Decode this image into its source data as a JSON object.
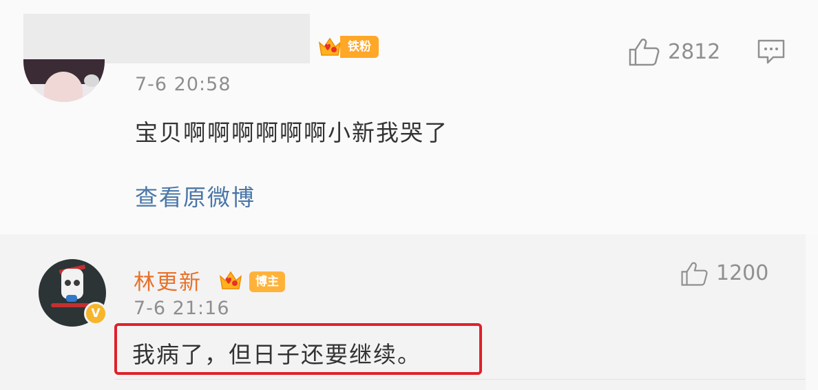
{
  "comment": {
    "fan_badge_label": "铁粉",
    "timestamp": "7-6 20:58",
    "text": "宝贝啊啊啊啊啊啊小新我哭了",
    "likes": "2812",
    "view_original_link": "查看原微博"
  },
  "reply": {
    "username": "林更新",
    "author_badge_label": "博主",
    "verified_mark": "V",
    "timestamp": "7-6 21:16",
    "likes": "1200",
    "text": "我病了，但日子还要继续。"
  },
  "colors": {
    "username": "#e8712a",
    "link": "#4a77a8",
    "badge": "#ffb23a",
    "highlight": "#e0202a",
    "muted": "#8e8e8e"
  },
  "icons": {
    "like": "thumbs-up-icon",
    "comment": "comment-bubble-icon",
    "crown": "crown-icon"
  }
}
